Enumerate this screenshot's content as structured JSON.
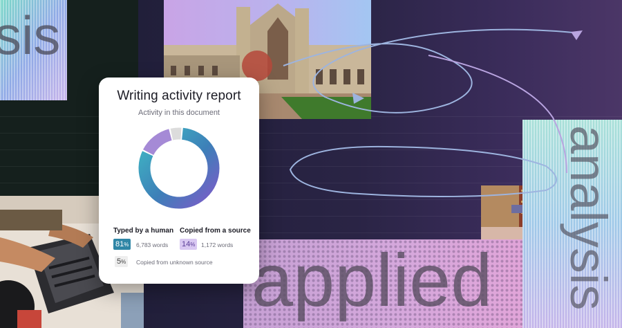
{
  "card": {
    "title": "Writing activity report",
    "subtitle": "Activity in this document",
    "typed_label": "Typed by a human",
    "typed_pct": "81",
    "typed_words": "6,783 words",
    "copied_label": "Copied from a source",
    "copied_pct": "14",
    "copied_words": "1,172 words",
    "unknown_pct": "5",
    "unknown_label": "Copied from unknown source",
    "pct_sign": "%",
    "donut": [
      {
        "name": "Typed by a human",
        "value": 81,
        "color": "#2f86a6"
      },
      {
        "name": "Copied from a source",
        "value": 14,
        "color": "#a58ad6"
      },
      {
        "name": "Copied from unknown source",
        "value": 5,
        "color": "#dcdcdc"
      }
    ]
  },
  "decor": {
    "word_applied": "applied",
    "word_sis": "sis",
    "word_right": "analysis"
  },
  "colors": {
    "accent_teal": "#3fb8c4",
    "accent_purple": "#8a5cc8",
    "arrow": "#b9a4e0"
  }
}
